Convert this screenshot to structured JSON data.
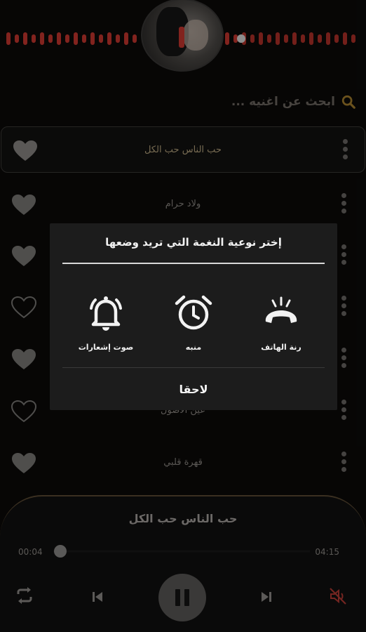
{
  "search": {
    "placeholder": "ابحث عن اغنيه ..."
  },
  "songs": [
    {
      "title": "حب الناس حب الكل",
      "liked": true,
      "active": true
    },
    {
      "title": "ولاد حرام",
      "liked": true,
      "active": false
    },
    {
      "title": "",
      "liked": true,
      "active": false
    },
    {
      "title": "",
      "liked": false,
      "active": false
    },
    {
      "title": "",
      "liked": true,
      "active": false
    },
    {
      "title": "عين الاصول",
      "liked": false,
      "active": false
    },
    {
      "title": "قهرة قلبي",
      "liked": true,
      "active": false
    }
  ],
  "modal": {
    "title": "إختر نوعية النغمة التي تريد وضعها",
    "options": [
      {
        "label": "رنة الهاتف",
        "icon": "phone-ringing-icon"
      },
      {
        "label": "منبه",
        "icon": "alarm-clock-icon"
      },
      {
        "label": "صوت إشعارات",
        "icon": "notification-bell-icon"
      }
    ],
    "later": "لاحقا"
  },
  "player": {
    "title": "حب الناس حب الكل",
    "current_time": "00:04",
    "duration": "04:15",
    "progress": 0.016,
    "muted": true
  },
  "colors": {
    "accent": "#c8362e",
    "active_title": "#b7a57f",
    "modal_bg": "#1c1c1c"
  }
}
